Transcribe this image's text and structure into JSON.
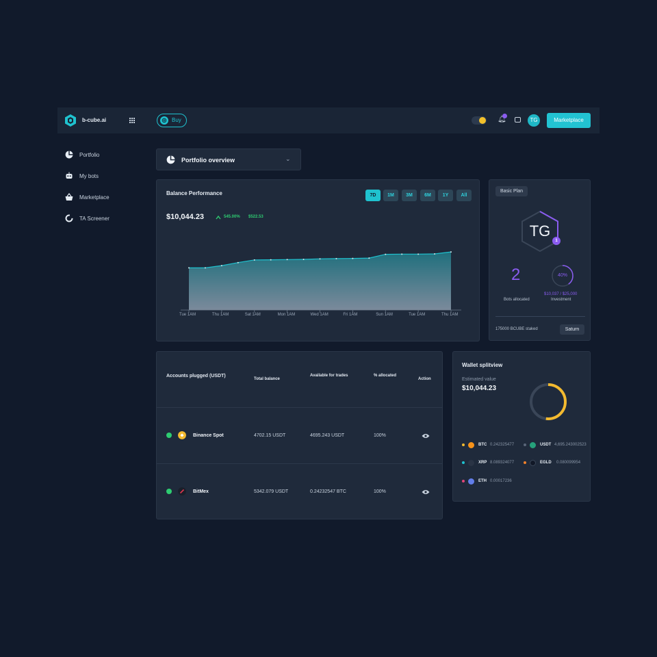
{
  "topbar": {
    "brand": "b-cube.ai",
    "buy_label": "Buy",
    "avatar_initials": "TG",
    "marketplace_label": "Marketplace"
  },
  "sidebar": {
    "items": [
      {
        "label": "Portfolio",
        "icon": "pie-chart-icon"
      },
      {
        "label": "My bots",
        "icon": "robot-icon"
      },
      {
        "label": "Marketplace",
        "icon": "basket-icon"
      },
      {
        "label": "TA Screener",
        "icon": "ring-chart-icon"
      }
    ]
  },
  "overview": {
    "label": "Portfolio overview"
  },
  "balance": {
    "title": "Balance Performance",
    "ranges": [
      "7D",
      "1M",
      "3M",
      "6M",
      "1Y",
      "All"
    ],
    "active_range": "7D",
    "value": "$10,044.23",
    "change_pct": "545.00%",
    "change_amount": "$522.53"
  },
  "chart_data": {
    "type": "area",
    "x": [
      "Tue 1AM",
      "",
      "Thu 1AM",
      "",
      "Sat 1AM",
      "",
      "Mon 1AM",
      "",
      "Wed 1AM",
      "",
      "Fri 1AM",
      "",
      "Sun 1AM",
      "",
      "Tue 1AM",
      "",
      "Thu 1AM"
    ],
    "xtick_labels": [
      "Tue 1AM",
      "Thu 1AM",
      "Sat 1AM",
      "Mon 1AM",
      "Wed 1AM",
      "Fri 1AM",
      "Sun 1AM",
      "Tue 1AM",
      "Thu 1AM"
    ],
    "values": [
      9620,
      9620,
      9680,
      9760,
      9830,
      9835,
      9840,
      9845,
      9860,
      9865,
      9870,
      9880,
      9980,
      9985,
      9985,
      9990,
      10044.23
    ],
    "ylim": [
      8500,
      10500
    ],
    "colors": {
      "line": "#1fc2cf",
      "fill_top": "#1f6f7d",
      "fill_bottom": "#7b8a9b"
    }
  },
  "plan": {
    "badge": "Basic Plan",
    "initials": "TG",
    "level": "1",
    "bots_count": "2",
    "bots_label": "Bots allocated",
    "investment_pct": "40%",
    "investment_fraction": 0.4,
    "investment_amount": "$10,037 / $25,000",
    "investment_label": "Investment",
    "staked": "175000 BCUBE staked",
    "tier_button": "Saturn"
  },
  "accounts": {
    "headers": [
      "Accounts plugged (USDT)",
      "Total balance",
      "Available for trades",
      "% allocated",
      "Action"
    ],
    "rows": [
      {
        "name": "Binance Spot",
        "total": "4702.15 USDT",
        "available": "4695.243 USDT",
        "allocated": "100%",
        "icon": "binance-icon",
        "icon_color": "#f3ba2f"
      },
      {
        "name": "BitMex",
        "total": "5342.079 USDT",
        "available": "0.24232547 BTC",
        "allocated": "100%",
        "icon": "bitmex-icon",
        "icon_color": "#1a1f2a"
      }
    ]
  },
  "wallet": {
    "title": "Wallet splitview",
    "est_label": "Estimated value",
    "est_value": "$10,044.23",
    "donut_fraction": 0.52,
    "legend": [
      {
        "symbol": "BTC",
        "amount": "0.242325477",
        "dot": "#f3ba2f",
        "icon_color": "#f7931a"
      },
      {
        "symbol": "USDT",
        "amount": "4,695.243002523",
        "dot": "#5a6679",
        "icon_color": "#26a17b"
      },
      {
        "symbol": "XRP",
        "amount": "8.089324077",
        "dot": "#1fc2cf",
        "icon_color": "#2a3445"
      },
      {
        "symbol": "EGLD",
        "amount": "0.080099954",
        "dot": "#f0812b",
        "icon_color": "#111827"
      },
      {
        "symbol": "ETH",
        "amount": "0.00017236",
        "dot": "#e2467a",
        "icon_color": "#627eea"
      }
    ]
  }
}
